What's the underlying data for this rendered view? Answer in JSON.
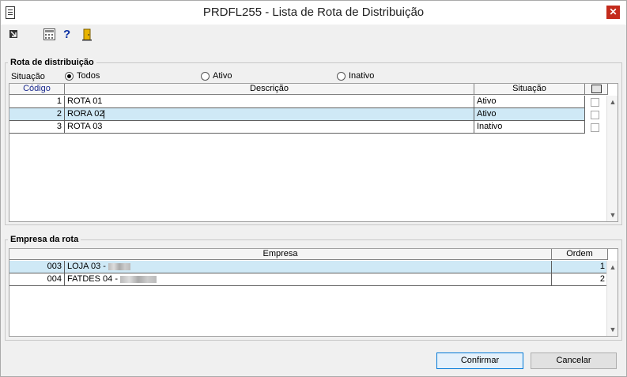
{
  "window": {
    "title": "PRDFL255 - Lista de Rota de Distribuição",
    "close_glyph": "✕"
  },
  "toolbar": {
    "icons": [
      "exit-icon",
      "calculator-icon",
      "help-icon",
      "door-icon"
    ],
    "help_glyph": "?"
  },
  "rota": {
    "legend": "Rota de distribuição",
    "situacao_label": "Situação",
    "filters": [
      {
        "label": "Todos",
        "selected": true
      },
      {
        "label": "Ativo",
        "selected": false
      },
      {
        "label": "Inativo",
        "selected": false
      }
    ],
    "columns": {
      "codigo": "Código",
      "descricao": "Descrição",
      "situacao": "Situação"
    },
    "rows": [
      {
        "codigo": "1",
        "descricao": "ROTA 01",
        "situacao": "Ativo",
        "selected": false
      },
      {
        "codigo": "2",
        "descricao": "RORA 02",
        "situacao": "Ativo",
        "selected": true
      },
      {
        "codigo": "3",
        "descricao": "ROTA 03",
        "situacao": "Inativo",
        "selected": false
      }
    ]
  },
  "empresa": {
    "legend": "Empresa da rota",
    "columns": {
      "empresa": "Empresa",
      "ordem": "Ordem"
    },
    "rows": [
      {
        "codigo": "003",
        "nome": "LOJA 03 -",
        "ordem": "1",
        "selected": true
      },
      {
        "codigo": "004",
        "nome": "FATDES 04 -",
        "ordem": "2",
        "selected": false
      }
    ]
  },
  "buttons": {
    "confirmar": "Confirmar",
    "cancelar": "Cancelar"
  }
}
